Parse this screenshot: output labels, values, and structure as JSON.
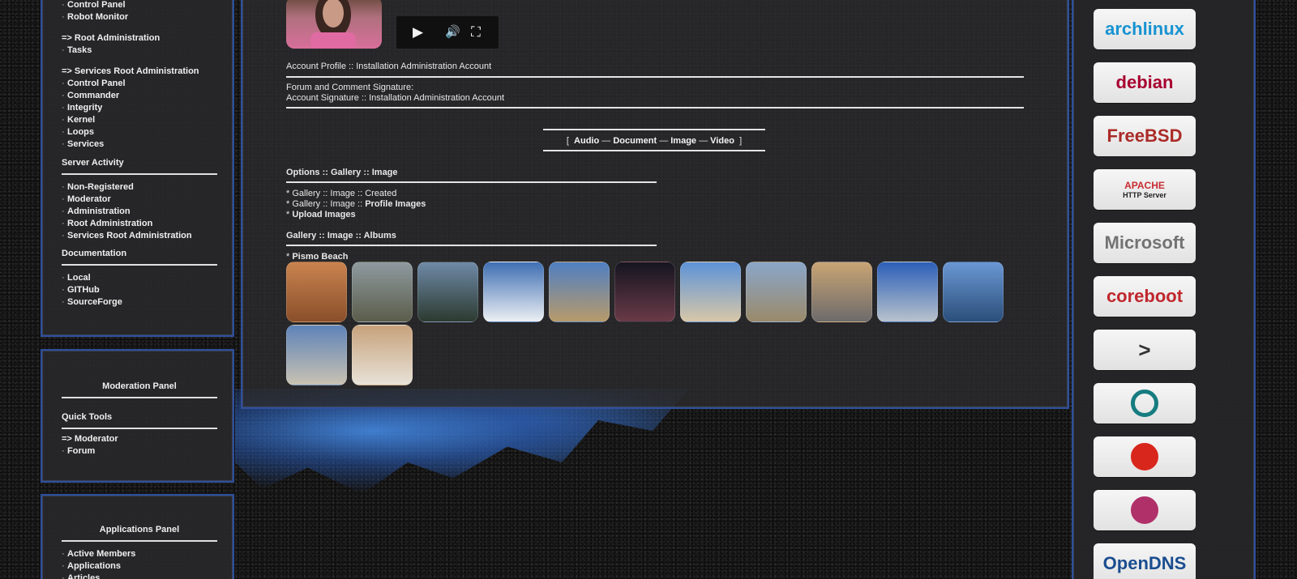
{
  "left_nav": {
    "items_top": [
      {
        "kind": "item",
        "label": "Control Panel"
      },
      {
        "kind": "item",
        "label": "Robot Monitor"
      },
      {
        "kind": "gap"
      },
      {
        "kind": "head",
        "label": "=> Root Administration"
      },
      {
        "kind": "item",
        "label": "Tasks"
      },
      {
        "kind": "gap"
      },
      {
        "kind": "head",
        "label": "=> Services Root Administration"
      },
      {
        "kind": "item",
        "label": "Control Panel"
      },
      {
        "kind": "item",
        "label": "Commander"
      },
      {
        "kind": "item",
        "label": "Integrity"
      },
      {
        "kind": "item",
        "label": "Kernel"
      },
      {
        "kind": "item",
        "label": "Loops"
      },
      {
        "kind": "item",
        "label": "Services"
      }
    ],
    "server_activity": {
      "title": "Server Activity",
      "items": [
        "Non-Registered",
        "Moderator",
        "Administration",
        "Root Administration",
        "Services Root Administration"
      ]
    },
    "documentation": {
      "title": "Documentation",
      "items": [
        "Local",
        "GITHub",
        "SourceForge"
      ]
    }
  },
  "moderation_panel": {
    "title": "Moderation Panel",
    "quick_tools_title": "Quick Tools",
    "moderator_link": "=> Moderator",
    "items": [
      "Forum"
    ]
  },
  "applications_panel": {
    "title": "Applications Panel",
    "items": [
      "Active Members",
      "Applications",
      "Articles"
    ]
  },
  "main": {
    "account_profile": "Account Profile :: Installation Administration Account",
    "signature_label": "Forum and Comment Signature:",
    "signature_value": "Account Signature :: Installation Administration Account",
    "media_links": {
      "open_bracket": "[",
      "close_bracket": "]",
      "sep": "—",
      "audio": "Audio",
      "document": "Document",
      "image": "Image",
      "video": "Video"
    },
    "options_title": "Options :: Gallery :: Image",
    "options": {
      "created": "* Gallery :: Image :: Created",
      "profile_prefix": "* Gallery :: Image :: ",
      "profile_link": "Profile Images",
      "upload_prefix": "* ",
      "upload_link": "Upload Images"
    },
    "albums_title": "Gallery :: Image :: Albums",
    "album_prefix": "* ",
    "album_name": "Pismo Beach",
    "thumbnails": [
      {
        "name": "selfie-sunglasses",
        "top": "#c9834f",
        "bottom": "#8a4f2a"
      },
      {
        "name": "portrait-trees",
        "top": "#8f9aa0",
        "bottom": "#5b5d4a"
      },
      {
        "name": "sun-over-beach",
        "top": "#6f8aa8",
        "bottom": "#2c3a30"
      },
      {
        "name": "sky-white",
        "top": "#3f6fb3",
        "bottom": "#eceff3"
      },
      {
        "name": "pismo-beach-sign",
        "top": "#4f7fc2",
        "bottom": "#b89a6a"
      },
      {
        "name": "fire-at-night",
        "top": "#151520",
        "bottom": "#6a3a48"
      },
      {
        "name": "portrait-beach",
        "top": "#5d93d7",
        "bottom": "#d8c7a8"
      },
      {
        "name": "person-on-dunes",
        "top": "#8aa6c9",
        "bottom": "#9a8a6a"
      },
      {
        "name": "pismo-beach-sign-2",
        "top": "#c9a474",
        "bottom": "#6d6b6b"
      },
      {
        "name": "sky-lamp",
        "top": "#2c5fb8",
        "bottom": "#b8c2cc"
      },
      {
        "name": "ocean-view",
        "top": "#6a98d4",
        "bottom": "#2b4f7a"
      },
      {
        "name": "rock-arch",
        "top": "#5e83b8",
        "bottom": "#c9c2b2"
      },
      {
        "name": "cave-arch",
        "top": "#c7a27c",
        "bottom": "#e8e2d8"
      }
    ]
  },
  "player": {
    "play_icon": "▶",
    "volume_icon": "🔊",
    "fullscreen_icon": "⛶"
  },
  "logos": [
    {
      "name": "archlinux",
      "text": "archlinux",
      "color": "#1793d1"
    },
    {
      "name": "debian",
      "text": "debian",
      "color": "#a80030"
    },
    {
      "name": "freebsd",
      "text": "FreeBSD",
      "color": "#ab2b28"
    },
    {
      "name": "apache",
      "text": "APACHE",
      "subtext": "HTTP Server",
      "color": "#c72d33"
    },
    {
      "name": "microsoft",
      "text": "Microsoft",
      "color": "#737373"
    },
    {
      "name": "coreboot",
      "text": "coreboot",
      "color": "#c0272d"
    },
    {
      "name": "terminal-app",
      "text": ">",
      "color": "#333333"
    },
    {
      "name": "lineageos",
      "text": "",
      "color": "#167c80"
    },
    {
      "name": "tomato",
      "text": "",
      "color": "#d9261c"
    },
    {
      "name": "lotus",
      "text": "",
      "color": "#b0306a"
    },
    {
      "name": "opendns",
      "text": "OpenDNS",
      "color": "#1a4d8f"
    }
  ]
}
